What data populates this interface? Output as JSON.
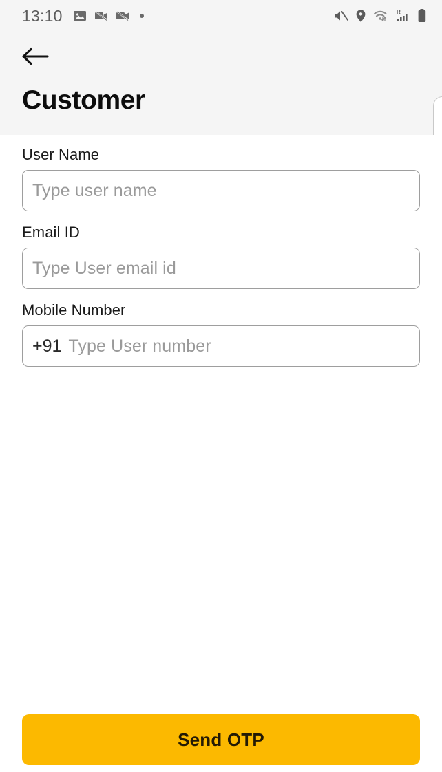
{
  "status_bar": {
    "time": "13:10",
    "left_icons": [
      "image-icon",
      "video-off-icon",
      "video-off-icon",
      "more-notifications-dot"
    ],
    "right_icons": [
      "mute-icon",
      "location-icon",
      "wifi-icon",
      "roaming-signal-icon",
      "battery-icon"
    ],
    "roaming_label": "R"
  },
  "header": {
    "back_icon": "back-arrow-icon",
    "title": "Customer"
  },
  "form": {
    "fields": [
      {
        "label": "User Name",
        "placeholder": "Type user name",
        "value": "",
        "prefix": null
      },
      {
        "label": "Email ID",
        "placeholder": "Type User email id",
        "value": "",
        "prefix": null
      },
      {
        "label": "Mobile Number",
        "placeholder": "Type User number",
        "value": "",
        "prefix": "+91"
      }
    ]
  },
  "cta": {
    "label": "Send OTP",
    "color": "#fcb900",
    "text_color": "#241a05"
  },
  "colors": {
    "header_bg": "#f5f5f5",
    "body_bg": "#ffffff",
    "input_border": "#9e9e9e",
    "placeholder": "#9a9a9a",
    "title": "#0d0d0d"
  }
}
